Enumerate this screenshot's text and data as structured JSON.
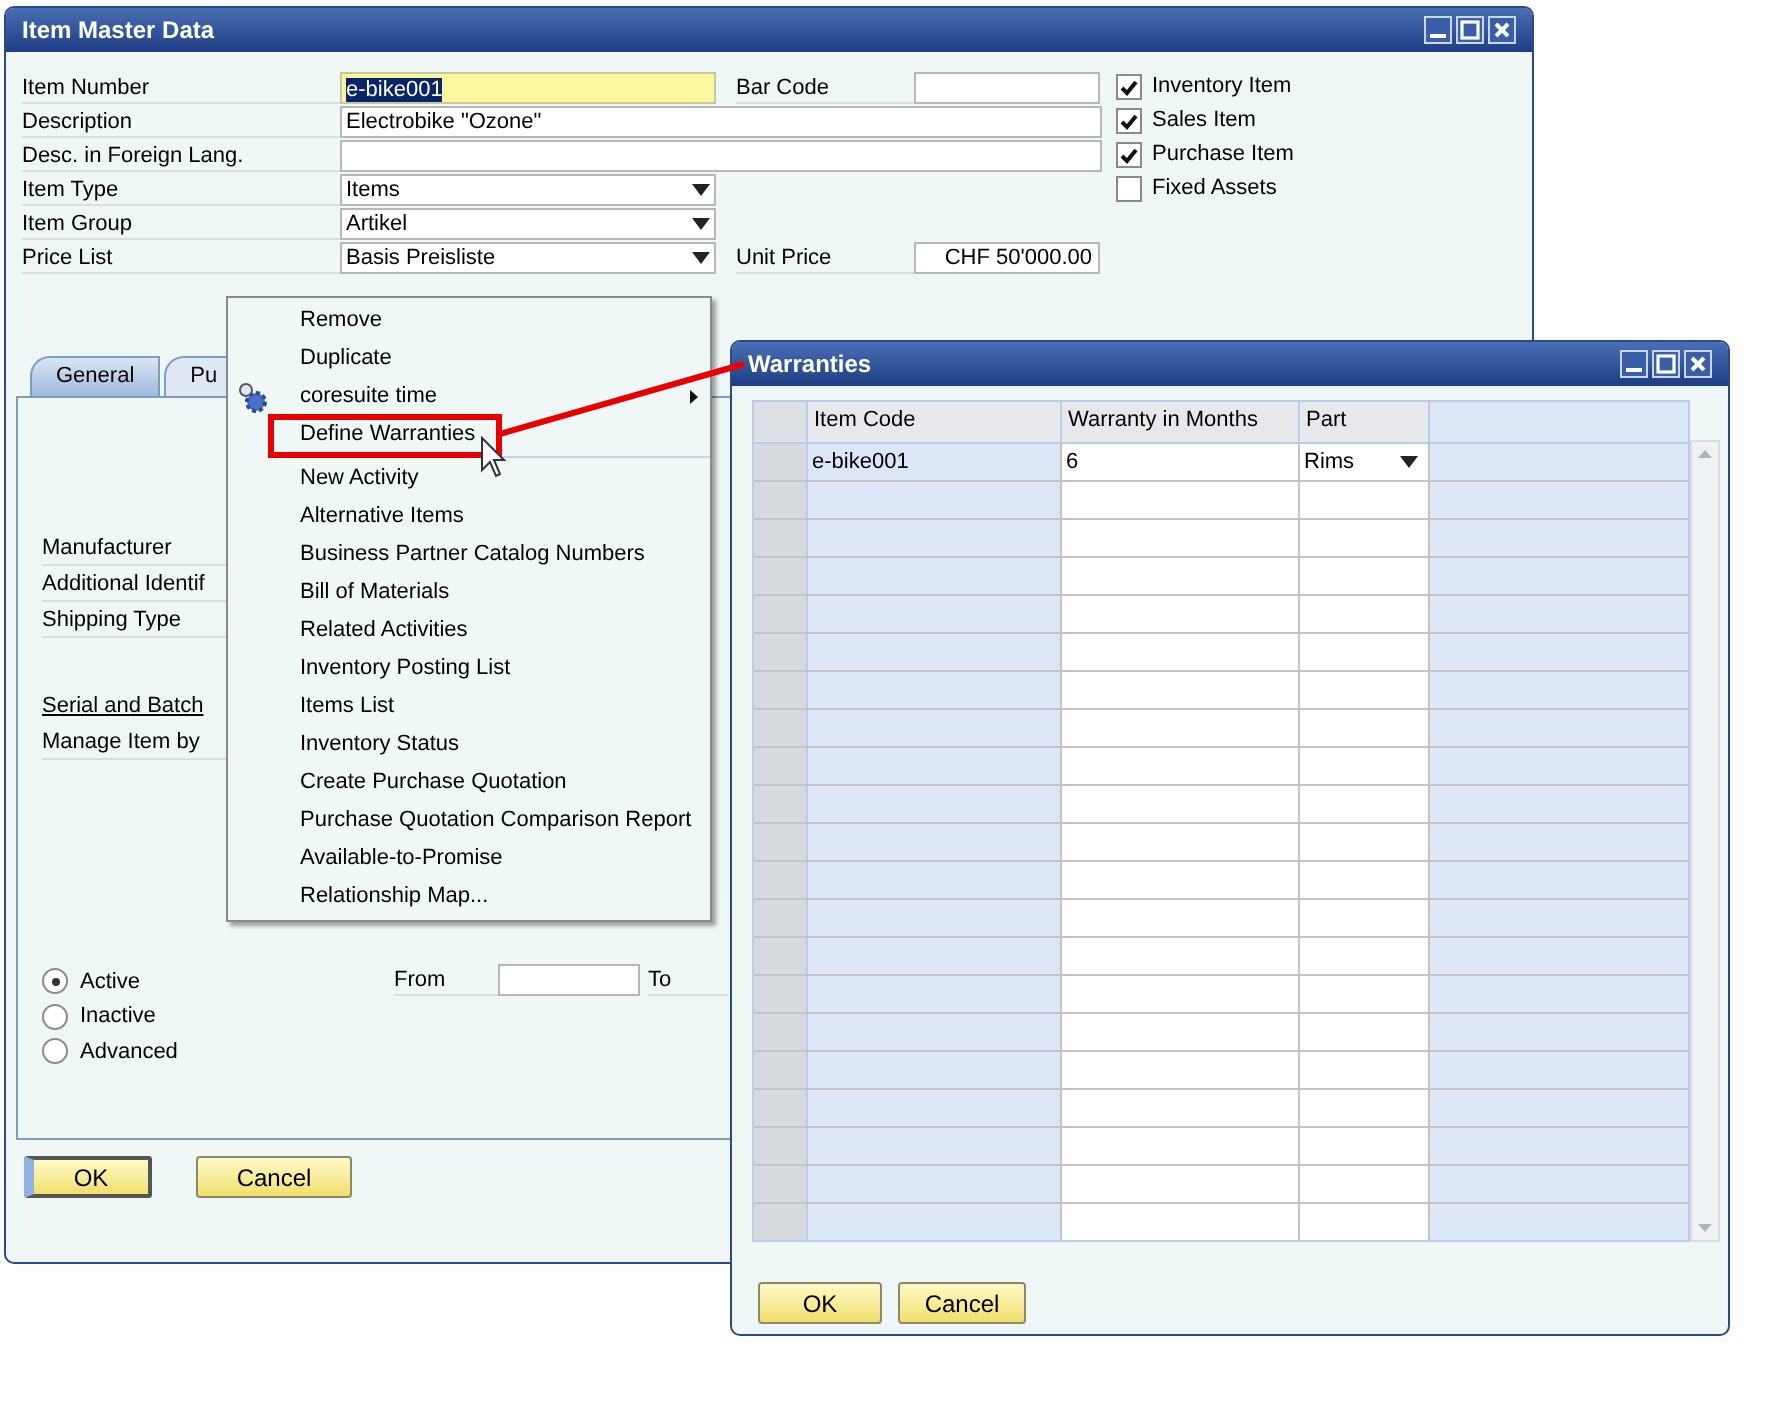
{
  "main_window": {
    "title": "Item Master Data",
    "header_fields": [
      {
        "label": "Item Number",
        "kind": "text",
        "value": "e-bike001",
        "focused": true,
        "side": {
          "label": "Bar Code"
        }
      },
      {
        "label": "Description",
        "kind": "wide",
        "value": "Electrobike \"Ozone\""
      },
      {
        "label": "Desc. in Foreign Lang.",
        "kind": "wide"
      },
      {
        "label": "Item Type",
        "kind": "dropdown",
        "value": "Items"
      },
      {
        "label": "Item Group",
        "kind": "dropdown",
        "value": "Artikel"
      },
      {
        "label": "Price List",
        "kind": "dropdown",
        "value": "Basis Preisliste",
        "side": {
          "label": "Unit Price",
          "value": "CHF 50'000.00"
        }
      }
    ],
    "flags": [
      {
        "label": "Inventory Item",
        "checked": true
      },
      {
        "label": "Sales Item",
        "checked": true
      },
      {
        "label": "Purchase Item",
        "checked": true
      },
      {
        "label": "Fixed Assets",
        "checked": false
      }
    ],
    "tabs": [
      {
        "label": "General",
        "selected": true
      },
      {
        "label": "Pu",
        "selected": false
      }
    ],
    "tab_fields": [
      "Manufacturer",
      "Additional Identif",
      "Shipping Type"
    ],
    "serial_section": {
      "title": "Serial and Batch",
      "field": "Manage Item by"
    },
    "status": [
      {
        "label": "Active",
        "selected": true
      },
      {
        "label": "Inactive",
        "selected": false
      },
      {
        "label": "Advanced",
        "selected": false
      }
    ],
    "period": {
      "from_label": "From",
      "to_label": "To"
    },
    "buttons": [
      "OK",
      "Cancel"
    ]
  },
  "context_menu": {
    "items": [
      {
        "label": "Remove",
        "kind": "plain"
      },
      {
        "label": "Duplicate",
        "kind": "plain"
      },
      {
        "label": "coresuite time",
        "kind": "submenu"
      },
      {
        "label": "Define Warranties",
        "kind": "plain",
        "annotated": true,
        "separator_after": true
      },
      {
        "label": "New Activity",
        "kind": "plain"
      },
      {
        "label": "Alternative Items",
        "kind": "plain"
      },
      {
        "label": "Business Partner Catalog Numbers",
        "kind": "plain"
      },
      {
        "label": "Bill of Materials",
        "kind": "plain"
      },
      {
        "label": "Related Activities",
        "kind": "plain"
      },
      {
        "label": "Inventory Posting List",
        "kind": "plain"
      },
      {
        "label": "Items List",
        "kind": "plain"
      },
      {
        "label": "Inventory Status",
        "kind": "plain"
      },
      {
        "label": "Create Purchase Quotation",
        "kind": "plain"
      },
      {
        "label": "Purchase Quotation Comparison Report",
        "kind": "plain"
      },
      {
        "label": "Available-to-Promise",
        "kind": "plain"
      },
      {
        "label": "Relationship Map...",
        "kind": "plain"
      }
    ]
  },
  "warranties_window": {
    "title": "Warranties",
    "columns": [
      "Item Code",
      "Warranty in Months",
      "Part"
    ],
    "rows": [
      {
        "cells": [
          "e-bike001",
          "6",
          "Rims"
        ]
      }
    ],
    "buttons": [
      "OK",
      "Cancel"
    ]
  }
}
